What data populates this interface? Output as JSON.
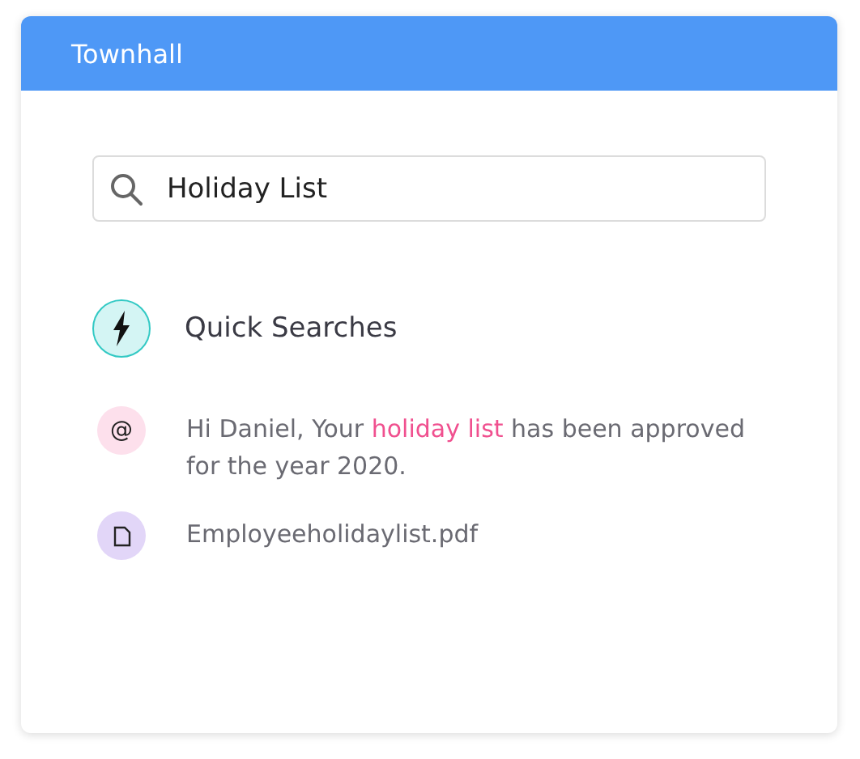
{
  "window": {
    "title": "Townhall"
  },
  "search": {
    "value": "Holiday List"
  },
  "quick_searches": {
    "label": "Quick Searches"
  },
  "results": [
    {
      "kind": "mention",
      "color": "#fde0ec",
      "icon_text": "@",
      "text_before": "Hi Daniel, Your ",
      "link": "holiday list",
      "text_after": " has been approved for the year 2020."
    },
    {
      "kind": "file",
      "color": "#e2d6f8",
      "text": "Employeeholidaylist.pdf"
    }
  ]
}
